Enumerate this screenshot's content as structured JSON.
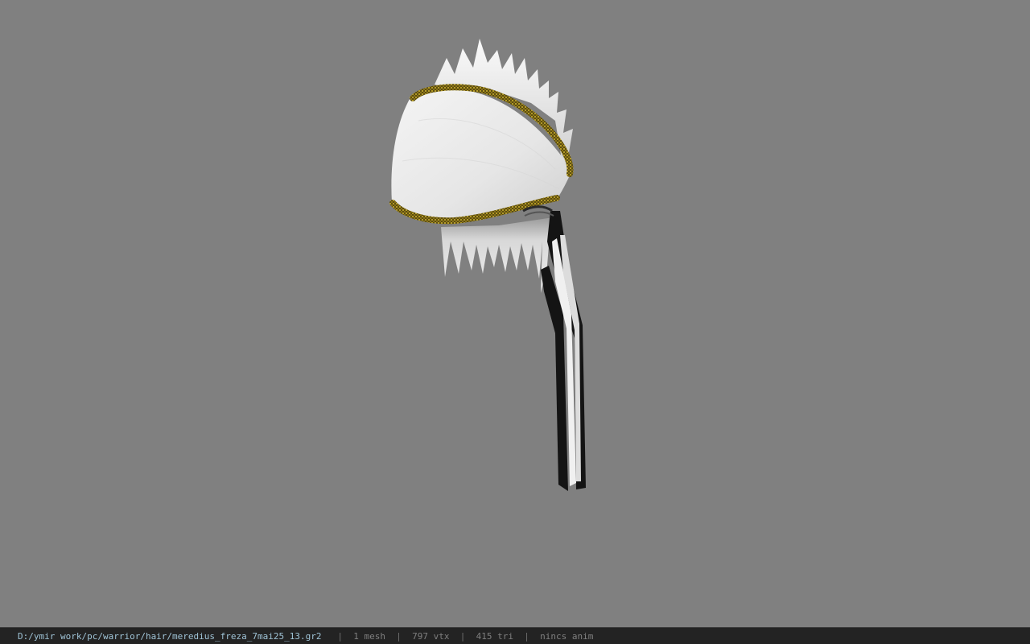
{
  "viewer": {
    "background_color": "#808080",
    "model": {
      "name": "hair-model",
      "colors": {
        "cap": "#e8e8e8",
        "trim": "#6b5a14",
        "trim_highlight": "#b8a02a",
        "ribbon_dark": "#141414",
        "ribbon_light": "#f2f2f2"
      }
    }
  },
  "status_bar": {
    "file_path": "D:/ymir work/pc/warrior/hair/meredius_freza_7mai25_13.gr2",
    "separator": "|",
    "mesh_count": "1 mesh",
    "vertex_count": "797 vtx",
    "triangle_count": "415 tri",
    "anim_info": "nincs anim"
  }
}
